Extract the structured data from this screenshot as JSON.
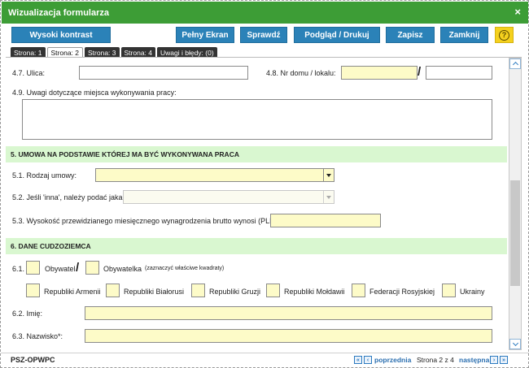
{
  "window": {
    "title": "Wizualizacja formularza",
    "close_symbol": "×"
  },
  "toolbar": {
    "contrast": "Wysoki kontrast",
    "fullscreen": "Pełny Ekran",
    "check": "Sprawdź",
    "preview": "Podgląd / Drukuj",
    "save": "Zapisz",
    "close": "Zamknij",
    "help": "?"
  },
  "tabs": [
    {
      "label": "Strona: 1",
      "active": false
    },
    {
      "label": "Strona: 2",
      "active": true
    },
    {
      "label": "Strona: 3",
      "active": false
    },
    {
      "label": "Strona: 4",
      "active": false
    },
    {
      "label": "Uwagi i błędy: (0)",
      "active": false
    }
  ],
  "form": {
    "street_label": "4.7. Ulica:",
    "house_label": "4.8. Nr domu / lokalu:",
    "separator": "/",
    "remarks_label": "4.9. Uwagi dotyczące miejsca wykonywania pracy:",
    "section5": "5. UMOWA NA PODSTAWIE KTÓREJ MA BYĆ WYKONYWANA PRACA",
    "contract_label": "5.1. Rodzaj umowy:",
    "other_label": "5.2. Jeśli 'inna', należy podać jaka:",
    "salary_label": "5.3. Wysokość przewidzianego miesięcznego wynagrodzenia brutto wynosi (PLN):",
    "section6": "6. DANE CUDZOZIEMCA",
    "citizenship_label": "6.1.",
    "citizen_m": "Obywatel",
    "citizen_f": "Obywatelka",
    "mark_note": "(zaznaczyć właściwe kwadraty)",
    "countries": [
      "Republiki Armenii",
      "Republiki Białorusi",
      "Republiki Gruzji",
      "Republiki Mołdawii",
      "Federacji Rosyjskiej",
      "Ukrainy"
    ],
    "first_name_label": "6.2. Imię:",
    "last_name_label": "6.3. Nazwisko*:"
  },
  "footer": {
    "code": "PSZ-OPWPC",
    "prev": "poprzednia",
    "page_info": "Strona 2 z 4",
    "next": "następna",
    "first_sym": "«",
    "prev_sym": "‹",
    "next_sym": "›",
    "last_sym": "»"
  },
  "colors": {
    "title_bar": "#3d9d36",
    "button": "#2b82b8",
    "section": "#d9f7d0",
    "input_yellow": "#fdfbc8",
    "help": "#f5d11e"
  }
}
